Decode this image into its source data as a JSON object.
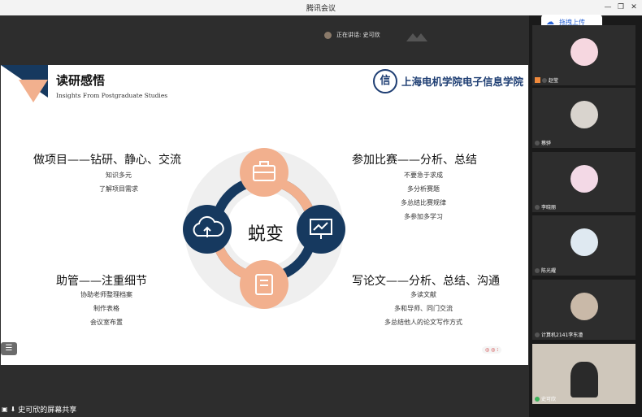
{
  "window": {
    "title": "腾讯会议"
  },
  "speaking": {
    "label": "正在讲话: 史可欣"
  },
  "upload": {
    "label": "拖拽上传"
  },
  "slide": {
    "title": "读研感悟",
    "subtitle": "Insights From Postgraduate Studies",
    "logo_text": "上海电机学院电子信息学院",
    "center": "蜕变",
    "sections": [
      {
        "heading": "做项目——钻研、静心、交流",
        "items": [
          "知识多元",
          "了解项目需求"
        ]
      },
      {
        "heading": "参加比赛——分析、总结",
        "items": [
          "不要急于求成",
          "多分析赛题",
          "多总结比赛规律",
          "多参加多学习"
        ]
      },
      {
        "heading": "助管——注重细节",
        "items": [
          "协助老师整理档案",
          "制作表格",
          "会议室布置"
        ]
      },
      {
        "heading": "写论文——分析、总结、沟通",
        "items": [
          "多读文献",
          "多和导师、同门交流",
          "多总结他人的论文写作方式"
        ]
      }
    ],
    "pager": "◎ ◎ ⁝"
  },
  "share": {
    "label": "史可欣的屏幕共享"
  },
  "participants": [
    {
      "name": "赵莹"
    },
    {
      "name": "蔡骅"
    },
    {
      "name": "李晓丽"
    },
    {
      "name": "陈光耀"
    },
    {
      "name": "计算机2141李东潼"
    },
    {
      "name": "史可欣"
    }
  ],
  "colors": {
    "navy": "#16395f",
    "peach": "#f2b08e",
    "ring": "#dcdcdc"
  }
}
